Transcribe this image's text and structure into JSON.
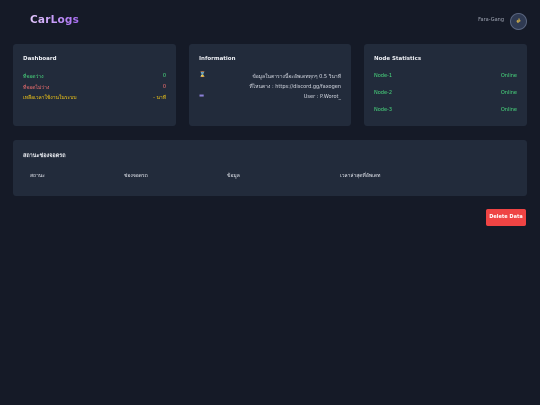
{
  "app": {
    "logo": "CarLogs"
  },
  "user": {
    "name": "Fara-Gang",
    "avatar_glyph": "#"
  },
  "dashboard": {
    "title": "Dashboard",
    "rows": [
      {
        "label": "ที่จอดว่าง",
        "value": "0",
        "color": "#4ade80"
      },
      {
        "label": "ที่จอดไม่ว่าง",
        "value": "0",
        "color": "#f87171"
      },
      {
        "label": "เหลือเวลาใช้งานในระบบ",
        "value": "- นาที",
        "color": "#facc15"
      }
    ]
  },
  "information": {
    "title": "Information",
    "rows": [
      {
        "icon": "hourglass-icon",
        "glyph": "⌛",
        "text": "ข้อมูลในตารางนี้จะอัพเดททุกๆ 0.5 วินาที"
      },
      {
        "icon": "",
        "glyph": "",
        "text": "ที่ไหนตาง : https://discord.gg/faxogen"
      },
      {
        "icon": "user-icon",
        "glyph": "▬",
        "text": "User : P.Worot_"
      }
    ]
  },
  "nodes": {
    "title": "Node Statistics",
    "items": [
      {
        "name": "Node-1",
        "status": "Online"
      },
      {
        "name": "Node-2",
        "status": "Online"
      },
      {
        "name": "Node-3",
        "status": "Online"
      }
    ]
  },
  "parking": {
    "title": "สถานะช่องจอดรถ",
    "columns": [
      "สถานะ",
      "ช่องจอดรถ",
      "ข้อมูล",
      "เวลาล่าสุดที่อัพเดท"
    ]
  },
  "actions": {
    "delete_label": "Delete Data"
  },
  "colors": {
    "background": "#151a27",
    "card": "#222b3b",
    "online": "#4ade80",
    "danger": "#ef4444"
  }
}
